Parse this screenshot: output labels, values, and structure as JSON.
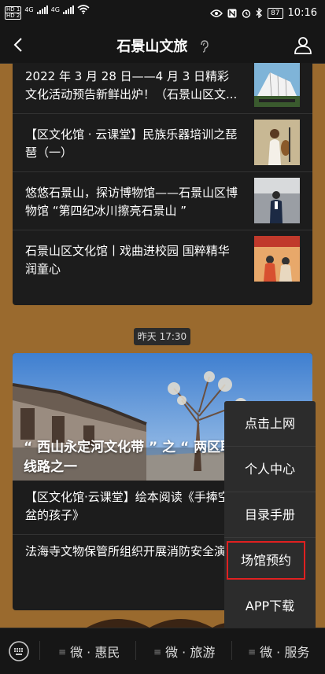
{
  "status": {
    "sim1": "HD 1",
    "sim2": "HD 2",
    "net1": "4G",
    "net2": "4G",
    "battery": "87",
    "time": "10:16"
  },
  "nav": {
    "title": "石景山文旅"
  },
  "feed1": {
    "items": [
      {
        "text": "2022 年 3 月 28 日——4 月 3 日精彩文化活动预告新鲜出炉！（石景山区文..."
      },
      {
        "text": "【区文化馆 · 云课堂】民族乐器培训之琵琶（一）"
      },
      {
        "text": "悠悠石景山，探访博物馆——石景山区博物馆 “第四纪冰川擦亮石景山 ”"
      },
      {
        "text": "石景山区文化馆丨戏曲进校园 国粹精华润童心"
      }
    ]
  },
  "date_chip": "昨天 17:30",
  "feed2": {
    "hero_title": "“ 西山永定河文化带 ” 之 “ 两区联动 ” 主题线路之一",
    "items": [
      {
        "text": "【区文化馆·云课堂】绘本阅读《手捧空花盆的孩子》"
      },
      {
        "text": "法海寺文物保管所组织开展消防安全演练"
      }
    ]
  },
  "popup_menu": {
    "items": [
      {
        "label": "点击上网"
      },
      {
        "label": "个人中心"
      },
      {
        "label": "目录手册"
      },
      {
        "label": "场馆预约",
        "highlighted": true
      },
      {
        "label": "APP下载"
      }
    ]
  },
  "bottom_tabs": [
    {
      "label": "微 · 惠民"
    },
    {
      "label": "微 · 旅游"
    },
    {
      "label": "微 · 服务"
    }
  ],
  "colors": {
    "background": "#9a6a2e",
    "card": "#1c1c1c",
    "bar": "#161616",
    "popup": "#2c2c2c",
    "highlight_border": "#e02020"
  }
}
